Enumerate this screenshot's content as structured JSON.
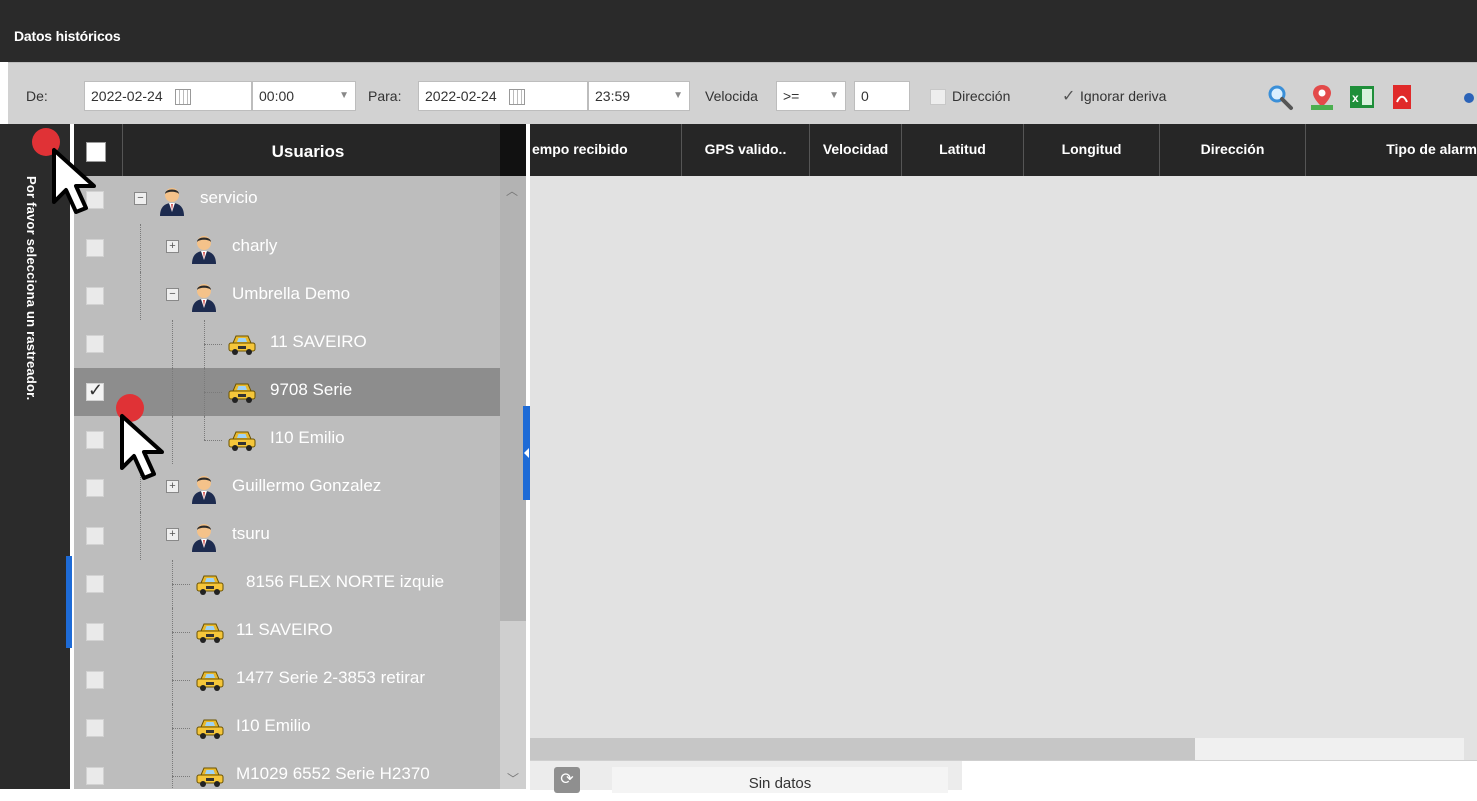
{
  "window": {
    "title": "Datos históricos"
  },
  "toolbar": {
    "from_label": "De:",
    "from_date": "2022-02-24",
    "from_time": "00:00",
    "to_label": "Para:",
    "to_date": "2022-02-24",
    "to_time": "23:59",
    "speed_label": "Velocida",
    "speed_operator": ">=",
    "speed_value": "0",
    "direction_label": "Dirección",
    "direction_checked": false,
    "ignore_drift_label": "Ignorar deriva",
    "ignore_drift_checked": true,
    "icons": [
      "search-icon",
      "map-marker-icon",
      "excel-icon",
      "pdf-icon"
    ]
  },
  "sidebar": {
    "hint": "Por favor selecciona un rastreador."
  },
  "tree": {
    "header": "Usuarios",
    "items": [
      {
        "label": "servicio",
        "type": "user",
        "expanded": true,
        "checked": false,
        "selected": false
      },
      {
        "label": "charly",
        "type": "user",
        "expanded": false,
        "checked": false,
        "selected": false
      },
      {
        "label": "Umbrella Demo",
        "type": "user",
        "expanded": true,
        "checked": false,
        "selected": false
      },
      {
        "label": "11 SAVEIRO",
        "type": "vehicle",
        "checked": false,
        "selected": false
      },
      {
        "label": "9708 Serie",
        "type": "vehicle",
        "checked": true,
        "selected": true
      },
      {
        "label": "I10 Emilio",
        "type": "vehicle",
        "checked": false,
        "selected": false
      },
      {
        "label": "Guillermo Gonzalez",
        "type": "user",
        "expanded": false,
        "checked": false,
        "selected": false
      },
      {
        "label": "tsuru",
        "type": "user",
        "expanded": false,
        "checked": false,
        "selected": false
      },
      {
        "label": "8156 FLEX NORTE izquie",
        "type": "vehicle",
        "checked": false,
        "selected": false
      },
      {
        "label": "11 SAVEIRO",
        "type": "vehicle",
        "checked": false,
        "selected": false
      },
      {
        "label": "1477 Serie 2-3853 retirar",
        "type": "vehicle",
        "checked": false,
        "selected": false
      },
      {
        "label": "I10 Emilio",
        "type": "vehicle",
        "checked": false,
        "selected": false
      },
      {
        "label": "M1029 6552 Serie H2370",
        "type": "vehicle",
        "checked": false,
        "selected": false
      }
    ]
  },
  "grid": {
    "columns": [
      "empo recibido",
      "GPS valido..",
      "Velocidad",
      "Latitud",
      "Longitud",
      "Dirección",
      "Tipo de alarm"
    ],
    "empty_text": "Sin datos"
  },
  "colors": {
    "accent": "#1e6bd6",
    "header_bg": "#262626",
    "selected_row": "#8d8d8d",
    "click_marker": "#e03236"
  }
}
